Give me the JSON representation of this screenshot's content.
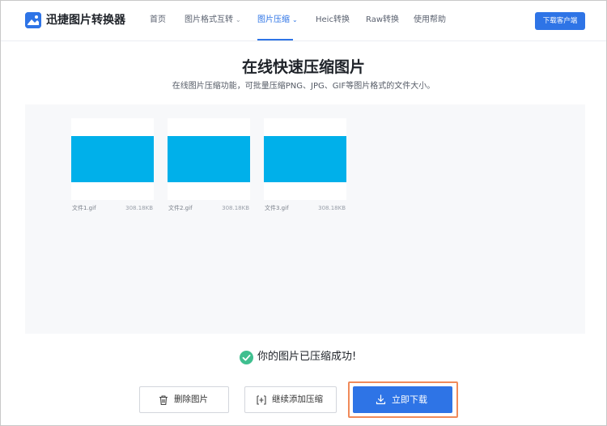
{
  "header": {
    "brand": "迅捷图片转换器",
    "nav": [
      {
        "label": "首页"
      },
      {
        "label": "图片格式互转"
      },
      {
        "label": "图片压缩"
      },
      {
        "label": "Heic转换"
      },
      {
        "label": "Raw转换"
      },
      {
        "label": "使用帮助"
      }
    ],
    "download_client": "下载客户端"
  },
  "main": {
    "title": "在线快速压缩图片",
    "subtitle": "在线图片压缩功能，可批量压缩PNG、JPG、GIF等图片格式的文件大小。"
  },
  "files": [
    {
      "name": "文件1.gif",
      "size": "308.18KB"
    },
    {
      "name": "文件2.gif",
      "size": "308.18KB"
    },
    {
      "name": "文件3.gif",
      "size": "308.18KB"
    }
  ],
  "status": {
    "message": "你的图片已压缩成功!"
  },
  "actions": {
    "delete": "删除图片",
    "add": "继续添加压缩",
    "download": "立即下载"
  },
  "colors": {
    "accent": "#2e74e6",
    "thumbnail": "#00b0ea",
    "success": "#3fbf8f",
    "highlight": "#f08a5a"
  }
}
